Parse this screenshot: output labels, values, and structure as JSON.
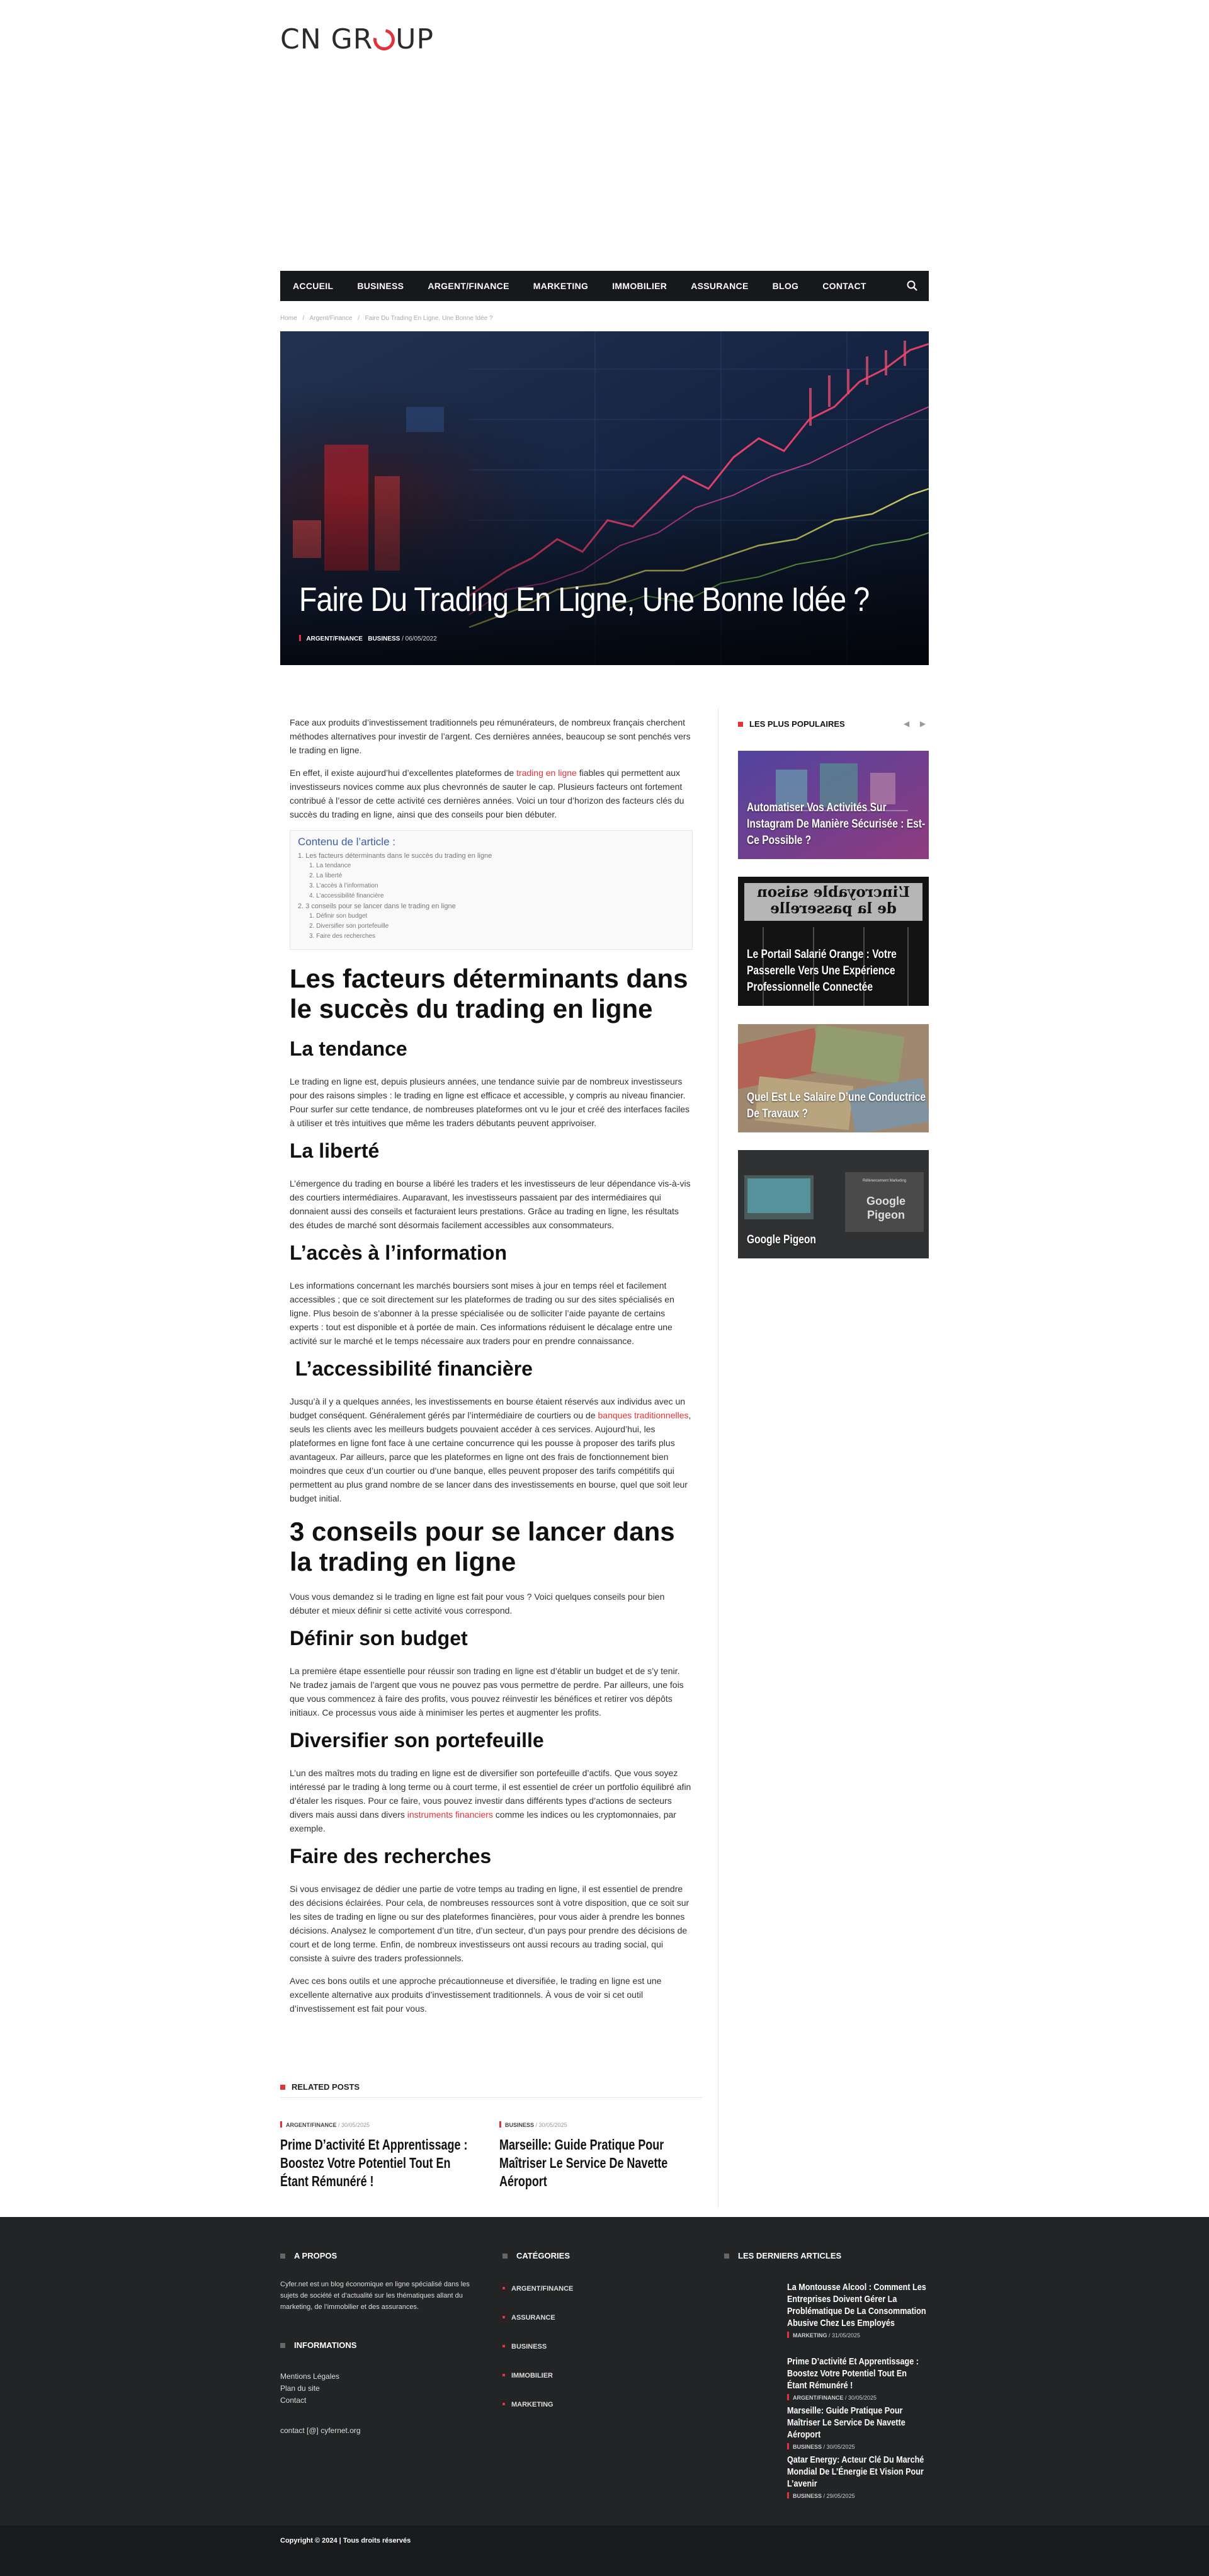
{
  "header": {
    "logo_text_1": "CN GR",
    "logo_text_2": "UP"
  },
  "nav": {
    "items": [
      "ACCUEIL",
      "BUSINESS",
      "ARGENT/FINANCE",
      "MARKETING",
      "IMMOBILIER",
      "ASSURANCE",
      "BLOG",
      "CONTACT"
    ],
    "search_icon": "search-icon"
  },
  "breadcrumb": [
    "Home",
    "/",
    "Argent/Finance",
    "/",
    "Faire Du Trading En Ligne, Une Bonne Idée ?"
  ],
  "hero": {
    "title": "Faire Du Trading En Ligne, Une Bonne Idée ?",
    "category_1": "ARGENT/FINANCE",
    "category_2": "BUSINESS",
    "date": "/ 06/05/2022"
  },
  "article": {
    "p1": "Face aux produits d’investissement traditionnels peu rémunérateurs, de nombreux français cherchent méthodes alternatives pour investir de l’argent. Ces dernières années, beaucoup se sont penchés vers le trading en ligne.",
    "p2_before": "En effet, il existe aujourd’hui d’excellentes plateformes de ",
    "p2_link": "trading en ligne",
    "p2_after": " fiables qui permettent aux investisseurs novices comme aux plus chevronnés de sauter le cap. Plusieurs facteurs ont fortement contribué à l’essor de cette activité ces dernières années. Voici un tour d’horizon des facteurs clés du succès du trading en ligne, ainsi que des conseils pour bien débuter.",
    "toc": {
      "title": "Contenu de l’article :",
      "items": [
        "1. Les facteurs déterminants dans le succès du trading en ligne",
        "1. La tendance",
        "2. La liberté",
        "3. L’accès à l’information",
        "4. L’accessibilité financière",
        "2. 3 conseils pour se lancer dans le trading en ligne",
        "1. Définir son budget",
        "2. Diversifier son portefeuille",
        "3. Faire des recherches"
      ]
    },
    "h2_1": "Les facteurs déterminants dans le succès du trading en ligne",
    "h3_1": "La tendance",
    "p3": "Le trading en ligne est, depuis plusieurs années, une tendance suivie par de nombreux investisseurs pour des raisons simples : le trading en ligne est efficace et accessible, y compris au niveau financier. Pour surfer sur cette tendance, de nombreuses plateformes ont vu le jour et créé des interfaces faciles à utiliser et très intuitives que même les traders débutants peuvent apprivoiser.",
    "h3_2": "La liberté",
    "p4": "L’émergence du trading en bourse a libéré les traders et les investisseurs de leur dépendance vis-à-vis des courtiers intermédiaires. Auparavant, les investisseurs passaient par des intermédiaires qui donnaient aussi des conseils et facturaient leurs prestations. Grâce au trading en ligne, les résultats des études de marché sont désormais facilement accessibles aux consommateurs.",
    "h3_3": "L’accès à l’information",
    "p5": "Les informations concernant les marchés boursiers sont mises à jour en temps réel et facilement accessibles ; que ce soit directement sur les plateformes de trading ou sur des sites spécialisés en ligne. Plus besoin de s’abonner à la presse spécialisée ou de solliciter l’aide payante de certains experts : tout est disponible et à portée de main. Ces informations réduisent le décalage entre une activité sur le marché et le temps nécessaire aux traders pour en prendre connaissance.",
    "h3_4": " L’accessibilité financière",
    "p6_before": "Jusqu’à il y a quelques années, les investissements en bourse étaient réservés aux individus avec un budget conséquent. Généralement gérés par l’intermédiaire de courtiers ou de ",
    "p6_link": "banques traditionnelles",
    "p6_after": ", seuls les clients avec les meilleurs budgets pouvaient accéder à ces services. Aujourd’hui, les plateformes en ligne font face à une certaine concurrence qui les pousse à proposer des tarifs plus avantageux. Par ailleurs, parce que les plateformes en ligne ont des frais de fonctionnement bien moindres que ceux d’un courtier ou d’une banque, elles peuvent proposer des tarifs compétitifs qui permettent au plus grand nombre de se lancer dans des investissements en bourse, quel que soit leur budget initial.",
    "h2_2": "3 conseils pour se lancer dans la trading en ligne",
    "p7": "Vous vous demandez si le trading en ligne est fait pour vous ? Voici quelques conseils pour bien débuter et mieux définir si cette activité vous correspond.",
    "h3_5": "Définir son budget",
    "p8": "La première étape essentielle pour réussir son trading en ligne est d’établir un budget et de s’y tenir. Ne tradez jamais de l’argent que vous ne pouvez pas vous permettre de perdre. Par ailleurs, une fois que vous commencez à faire des profits, vous pouvez réinvestir les bénéfices et retirer vos dépôts initiaux. Ce processus vous aide à minimiser les pertes et augmenter les profits.",
    "h3_6": "Diversifier son portefeuille",
    "p9_before": "L’un des maîtres mots du trading en ligne est de diversifier son portefeuille d’actifs. Que vous soyez intéressé par le trading à long terme ou à court terme, il est essentiel de créer un portfolio équilibré afin d’étaler les risques. Pour ce faire, vous pouvez investir dans différents types d’actions de secteurs divers mais aussi dans divers ",
    "p9_link": "instruments financiers",
    "p9_after": " comme les indices ou les cryptomonnaies, par exemple.",
    "h3_7": "Faire des recherches",
    "p10": "Si vous envisagez de dédier une partie de votre temps au trading en ligne, il est essentiel de prendre des décisions éclairées. Pour cela, de nombreuses ressources sont à votre disposition, que ce soit sur les sites de trading en ligne ou sur des plateformes financières, pour vous aider à prendre les bonnes décisions. Analysez le comportement d’un titre, d’un secteur, d’un pays pour prendre des décisions de court et de long terme. Enfin, de nombreux investisseurs ont aussi recours au trading social, qui consiste à suivre des traders professionnels.",
    "p11": "Avec ces bons outils et une approche précautionneuse et diversifiée, le trading en ligne est une excellente alternative aux produits d’investissement traditionnels. À vous de voir si cet outil d’investissement est fait pour vous."
  },
  "sidebar": {
    "heading": "LES PLUS POPULAIRES",
    "prev": "◀",
    "next": "▶",
    "cards": [
      {
        "title": "Automatiser Vos Activités Sur Instagram De Manière Sécurisée : Est-Ce Possible ?"
      },
      {
        "title": "Le Portail Salarié Orange : Votre Passerelle Vers Une Expérience Professionnelle Connectée",
        "overlay": "L’incroyable saison de la passerelle"
      },
      {
        "title": "Quel Est Le Salaire D’une Conductrice De Travaux ?"
      },
      {
        "title": "Google Pigeon",
        "overlay_small": "Référencement Marketing",
        "overlay": "Google Pigeon"
      }
    ]
  },
  "related": {
    "heading": "RELATED POSTS",
    "posts": [
      {
        "category": "ARGENT/FINANCE",
        "date": "/ 30/05/2025",
        "title": "Prime D’activité Et Apprentissage : Boostez Votre Potentiel Tout En Étant Rémunéré !"
      },
      {
        "category": "BUSINESS",
        "date": "/ 30/05/2025",
        "title": "Marseille: Guide Pratique Pour Maîtriser Le Service De Navette Aéroport"
      }
    ]
  },
  "footer": {
    "about_heading": "A PROPOS",
    "about_text": "Cyfer.net est un blog économique en ligne spécialisé dans les sujets de société et d’actualité sur les thématiques allant du marketing, de l’immobilier et des assurances.",
    "info_heading": "INFORMATIONS",
    "info_links": [
      "Mentions Légales",
      "Plan du site",
      "Contact"
    ],
    "contact": "contact [@] cyfernet.org",
    "cat_heading": "CATÉGORIES",
    "categories": [
      "ARGENT/FINANCE",
      "ASSURANCE",
      "BUSINESS",
      "IMMOBILIER",
      "MARKETING"
    ],
    "latest_heading": "LES DERNIERS ARTICLES",
    "latest": [
      {
        "title": "La Montousse Alcool : Comment Les Entreprises Doivent Gérer La Problématique De La Consommation Abusive Chez Les Employés",
        "category": "MARKETING",
        "date": "/ 31/05/2025"
      },
      {
        "title": "Prime D’activité Et Apprentissage : Boostez Votre Potentiel Tout En Étant Rémunéré !",
        "category": "ARGENT/FINANCE",
        "date": "/ 30/05/2025"
      },
      {
        "title": "Marseille: Guide Pratique Pour Maîtriser Le Service De Navette Aéroport",
        "category": "BUSINESS",
        "date": "/ 30/05/2025"
      },
      {
        "title": "Qatar Energy: Acteur Clé Du Marché Mondial De L’Énergie Et Vision Pour L’avenir",
        "category": "BUSINESS",
        "date": "/ 29/05/2025"
      }
    ],
    "copyright": "Copyright © 2024 | Tous droits réservés"
  }
}
